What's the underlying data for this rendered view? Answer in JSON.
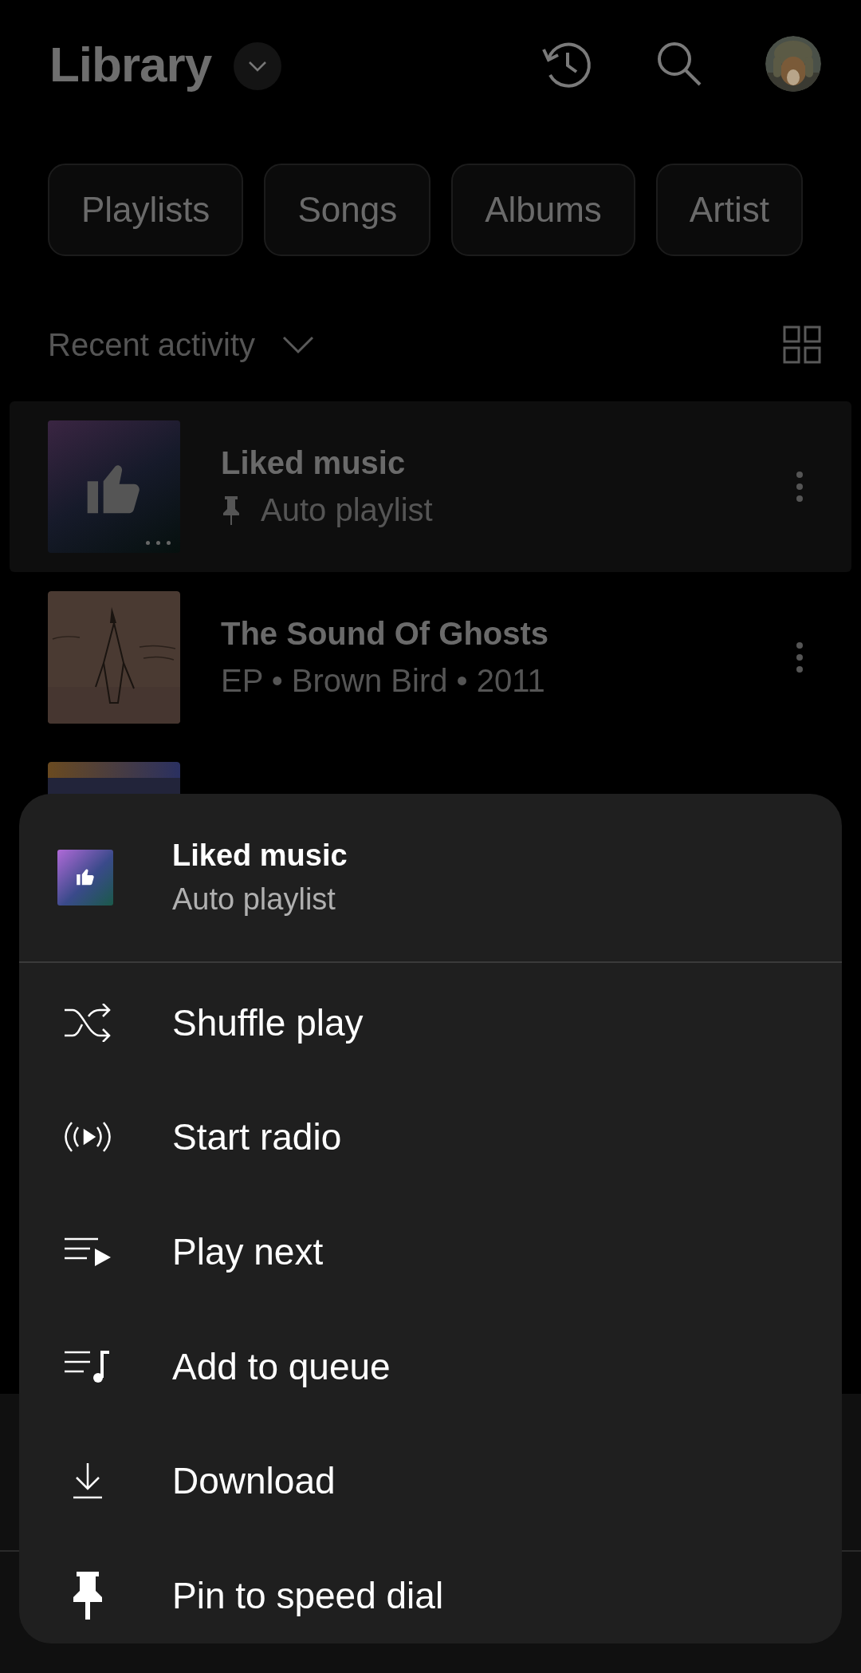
{
  "header": {
    "title": "Library"
  },
  "chips": [
    {
      "label": "Playlists"
    },
    {
      "label": "Songs"
    },
    {
      "label": "Albums"
    },
    {
      "label": "Artist"
    }
  ],
  "sort": {
    "label": "Recent activity"
  },
  "items": [
    {
      "kind": "liked",
      "title": "Liked music",
      "subtitle": "Auto playlist",
      "pinned": true,
      "selected": true
    },
    {
      "kind": "album",
      "title": "The Sound Of Ghosts",
      "subtitle": "EP • Brown Bird • 2011",
      "pinned": false,
      "selected": false
    },
    {
      "kind": "partial",
      "selected": false
    }
  ],
  "sheet": {
    "title": "Liked music",
    "subtitle": "Auto playlist",
    "actions": [
      {
        "kind": "shuffle",
        "label": "Shuffle play"
      },
      {
        "kind": "radio",
        "label": "Start radio"
      },
      {
        "kind": "next",
        "label": "Play next"
      },
      {
        "kind": "queue",
        "label": "Add to queue"
      },
      {
        "kind": "download",
        "label": "Download"
      },
      {
        "kind": "pin",
        "label": "Pin to speed dial"
      }
    ]
  }
}
